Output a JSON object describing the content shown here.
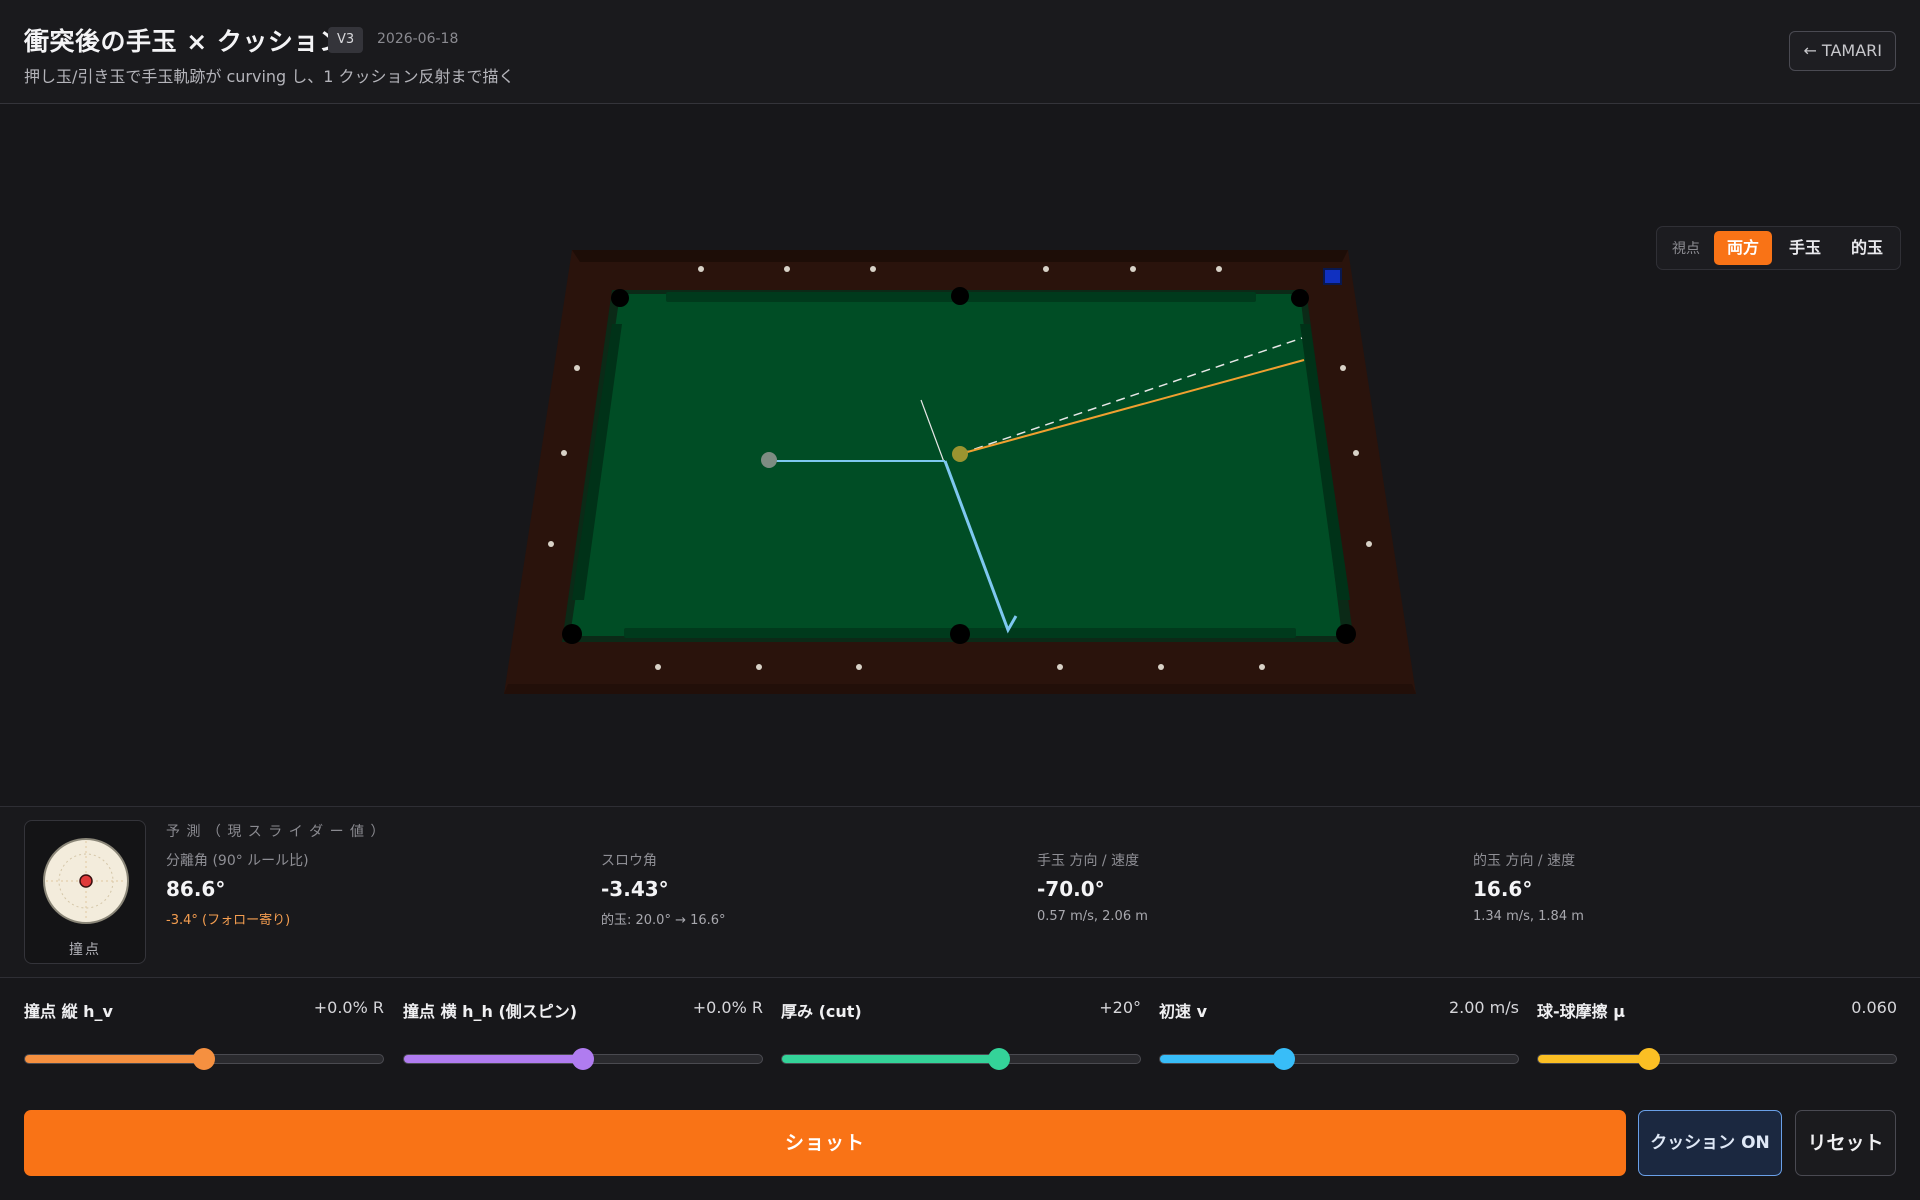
{
  "header": {
    "title": "衝突後の手玉 × クッション",
    "version": "V3",
    "date": "2026-06-18",
    "subtitle": "押し玉/引き玉で手玉軌跡が curving し、1 クッション反射まで描く",
    "back_label": "← TAMARI"
  },
  "view_control": {
    "label": "視点",
    "options": [
      "両方",
      "手玉",
      "的玉"
    ],
    "selected": "両方"
  },
  "colors": {
    "accent": "#f97316",
    "felt": "#004d25",
    "rail": "#2a130c",
    "cue_path": "#7ec8f0",
    "object_path": "#f0a030",
    "marker": "#1030c0"
  },
  "prediction": {
    "heading": "予 測 （ 現 ス ラ イ ダ ー 値 ）",
    "contact_label": "撞点",
    "metrics": [
      {
        "label": "分離角 (90° ルール比)",
        "value": "86.6°",
        "sub": "-3.4° (フォロー寄り)",
        "sub_warn": true
      },
      {
        "label": "スロウ角",
        "value": "-3.43°",
        "sub": "的玉: 20.0° → 16.6°",
        "sub_warn": false
      },
      {
        "label": "手玉 方向 / 速度",
        "value": "-70.0°",
        "sub": "0.57 m/s, 2.06 m",
        "sub_warn": false
      },
      {
        "label": "的玉 方向 / 速度",
        "value": "16.6°",
        "sub": "1.34 m/s, 1.84 m",
        "sub_warn": false
      }
    ]
  },
  "sliders": [
    {
      "label": "撞点 縦 h_v",
      "value": "+0.0% R",
      "fraction": 0.5,
      "color": "#f59040"
    },
    {
      "label": "撞点 横 h_h (側スピン)",
      "value": "+0.0% R",
      "fraction": 0.5,
      "color": "#b07cf0"
    },
    {
      "label": "厚み (cut)",
      "value": "+20°",
      "fraction": 0.606,
      "color": "#34d399"
    },
    {
      "label": "初速 v",
      "value": "2.00 m/s",
      "fraction": 0.345,
      "color": "#38bdf8"
    },
    {
      "label": "球-球摩擦 μ",
      "value": "0.060",
      "fraction": 0.31,
      "color": "#fbbf24"
    }
  ],
  "actions": {
    "shot": "ショット",
    "cushion": "クッション ON",
    "reset": "リセット"
  }
}
